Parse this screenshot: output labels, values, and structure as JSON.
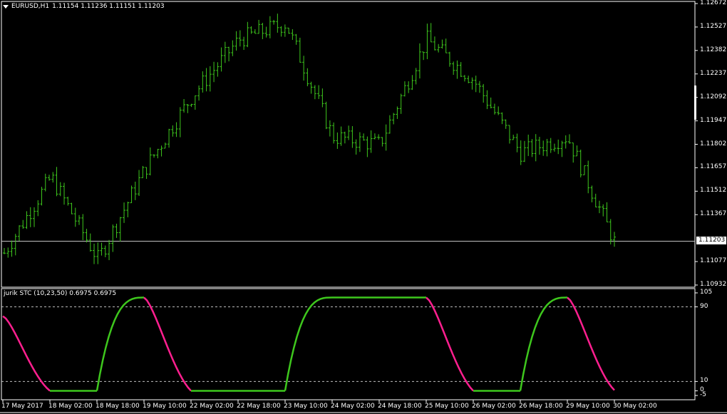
{
  "header": {
    "symbol": "EURUSD,H1",
    "ohlc": "1.11154 1.11236 1.11151 1.11203"
  },
  "indicator": {
    "label": "jurik STC (10,23,50) 0.6975 0.6975"
  },
  "colors": {
    "background": "#000000",
    "candle": "#3ec71d",
    "stc_up": "#3ec71d",
    "stc_down": "#ff1f8f",
    "grid": "#c0c0c0",
    "text": "#ffffff"
  },
  "price_axis": {
    "labels": [
      "1.12672",
      "1.12527",
      "1.12382",
      "1.12237",
      "1.12092",
      "1.11947",
      "1.11802",
      "1.11657",
      "1.11512",
      "1.11367",
      "1.11077",
      "1.10932"
    ],
    "current": "1.11203"
  },
  "indicator_axis": {
    "labels": [
      "105",
      "90",
      "10",
      "0",
      "-5"
    ]
  },
  "time_axis": {
    "labels": [
      "17 May 2017",
      "18 May 02:00",
      "18 May 18:00",
      "19 May 10:00",
      "22 May 02:00",
      "22 May 18:00",
      "23 May 10:00",
      "24 May 02:00",
      "24 May 18:00",
      "25 May 10:00",
      "26 May 02:00",
      "26 May 18:00",
      "29 May 10:00",
      "30 May 02:00"
    ]
  },
  "chart_data": [
    {
      "type": "line",
      "title": "EURUSD,H1",
      "ylim": [
        1.10932,
        1.12672
      ],
      "y_ticks": [
        1.12672,
        1.12527,
        1.12382,
        1.12237,
        1.12092,
        1.11947,
        1.11802,
        1.11657,
        1.11512,
        1.11367,
        1.11077,
        1.10932
      ],
      "series": [
        {
          "name": "EURUSD,H1",
          "x": [
            "17 May 2017",
            "18 May 02:00",
            "18 May 18:00",
            "19 May 10:00",
            "22 May 02:00",
            "22 May 18:00",
            "23 May 10:00",
            "24 May 02:00",
            "24 May 18:00",
            "25 May 10:00",
            "26 May 02:00",
            "26 May 18:00",
            "29 May 10:00",
            "30 May 02:00"
          ],
          "values": [
            1.1113,
            1.116,
            1.1109,
            1.1165,
            1.121,
            1.1245,
            1.1255,
            1.1185,
            1.118,
            1.1245,
            1.122,
            1.1175,
            1.1185,
            1.112
          ]
        }
      ]
    },
    {
      "type": "line",
      "title": "jurik STC (10,23,50) 0.6975 0.6975",
      "ylim": [
        -5,
        105
      ],
      "y_ticks": [
        105,
        90,
        10,
        0,
        -5
      ],
      "series": [
        {
          "name": "jurik STC (10,23,50)",
          "x": [
            "17 May 2017",
            "18 May 02:00",
            "18 May 18:00",
            "19 May 10:00",
            "22 May 02:00",
            "22 May 18:00",
            "23 May 10:00",
            "24 May 02:00",
            "24 May 18:00",
            "25 May 10:00",
            "26 May 02:00",
            "26 May 18:00",
            "29 May 10:00",
            "30 May 02:00"
          ],
          "values": [
            80,
            0,
            0,
            100,
            0,
            0,
            0,
            100,
            100,
            100,
            0,
            0,
            100,
            0.6975
          ]
        }
      ]
    }
  ]
}
